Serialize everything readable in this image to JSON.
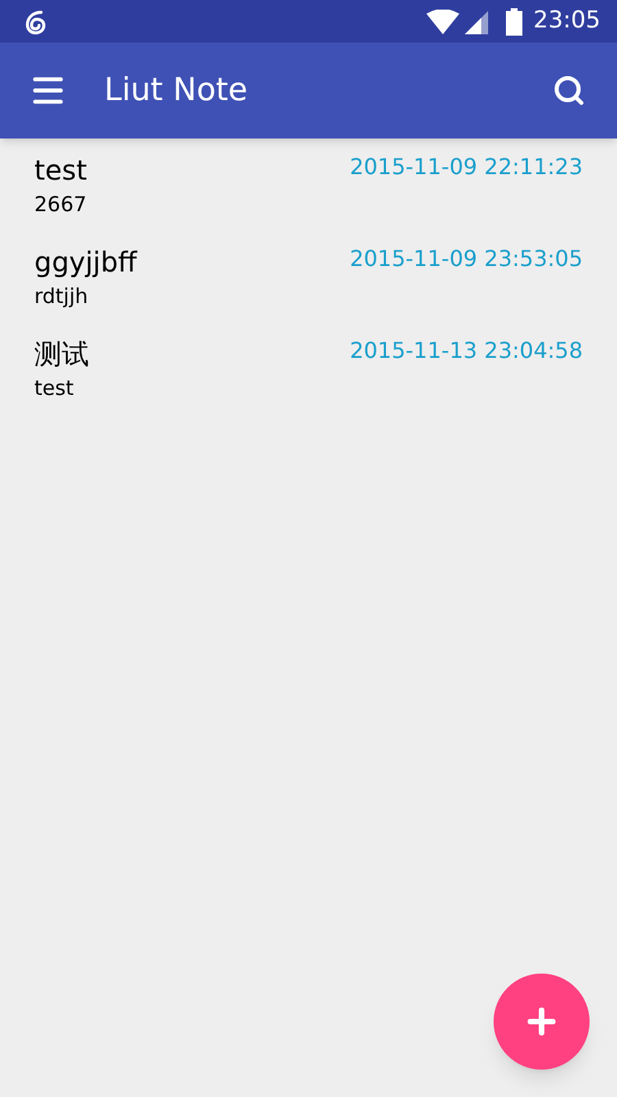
{
  "status_bar": {
    "time": "23:05"
  },
  "app_bar": {
    "title": "Liut Note"
  },
  "notes": [
    {
      "title": "test",
      "body": "2667",
      "timestamp": "2015-11-09 22:11:23"
    },
    {
      "title": "ggyjjbff",
      "body": "rdtjjh",
      "timestamp": "2015-11-09 23:53:05"
    },
    {
      "title": "测试",
      "body": "test",
      "timestamp": "2015-11-13 23:04:58"
    }
  ]
}
